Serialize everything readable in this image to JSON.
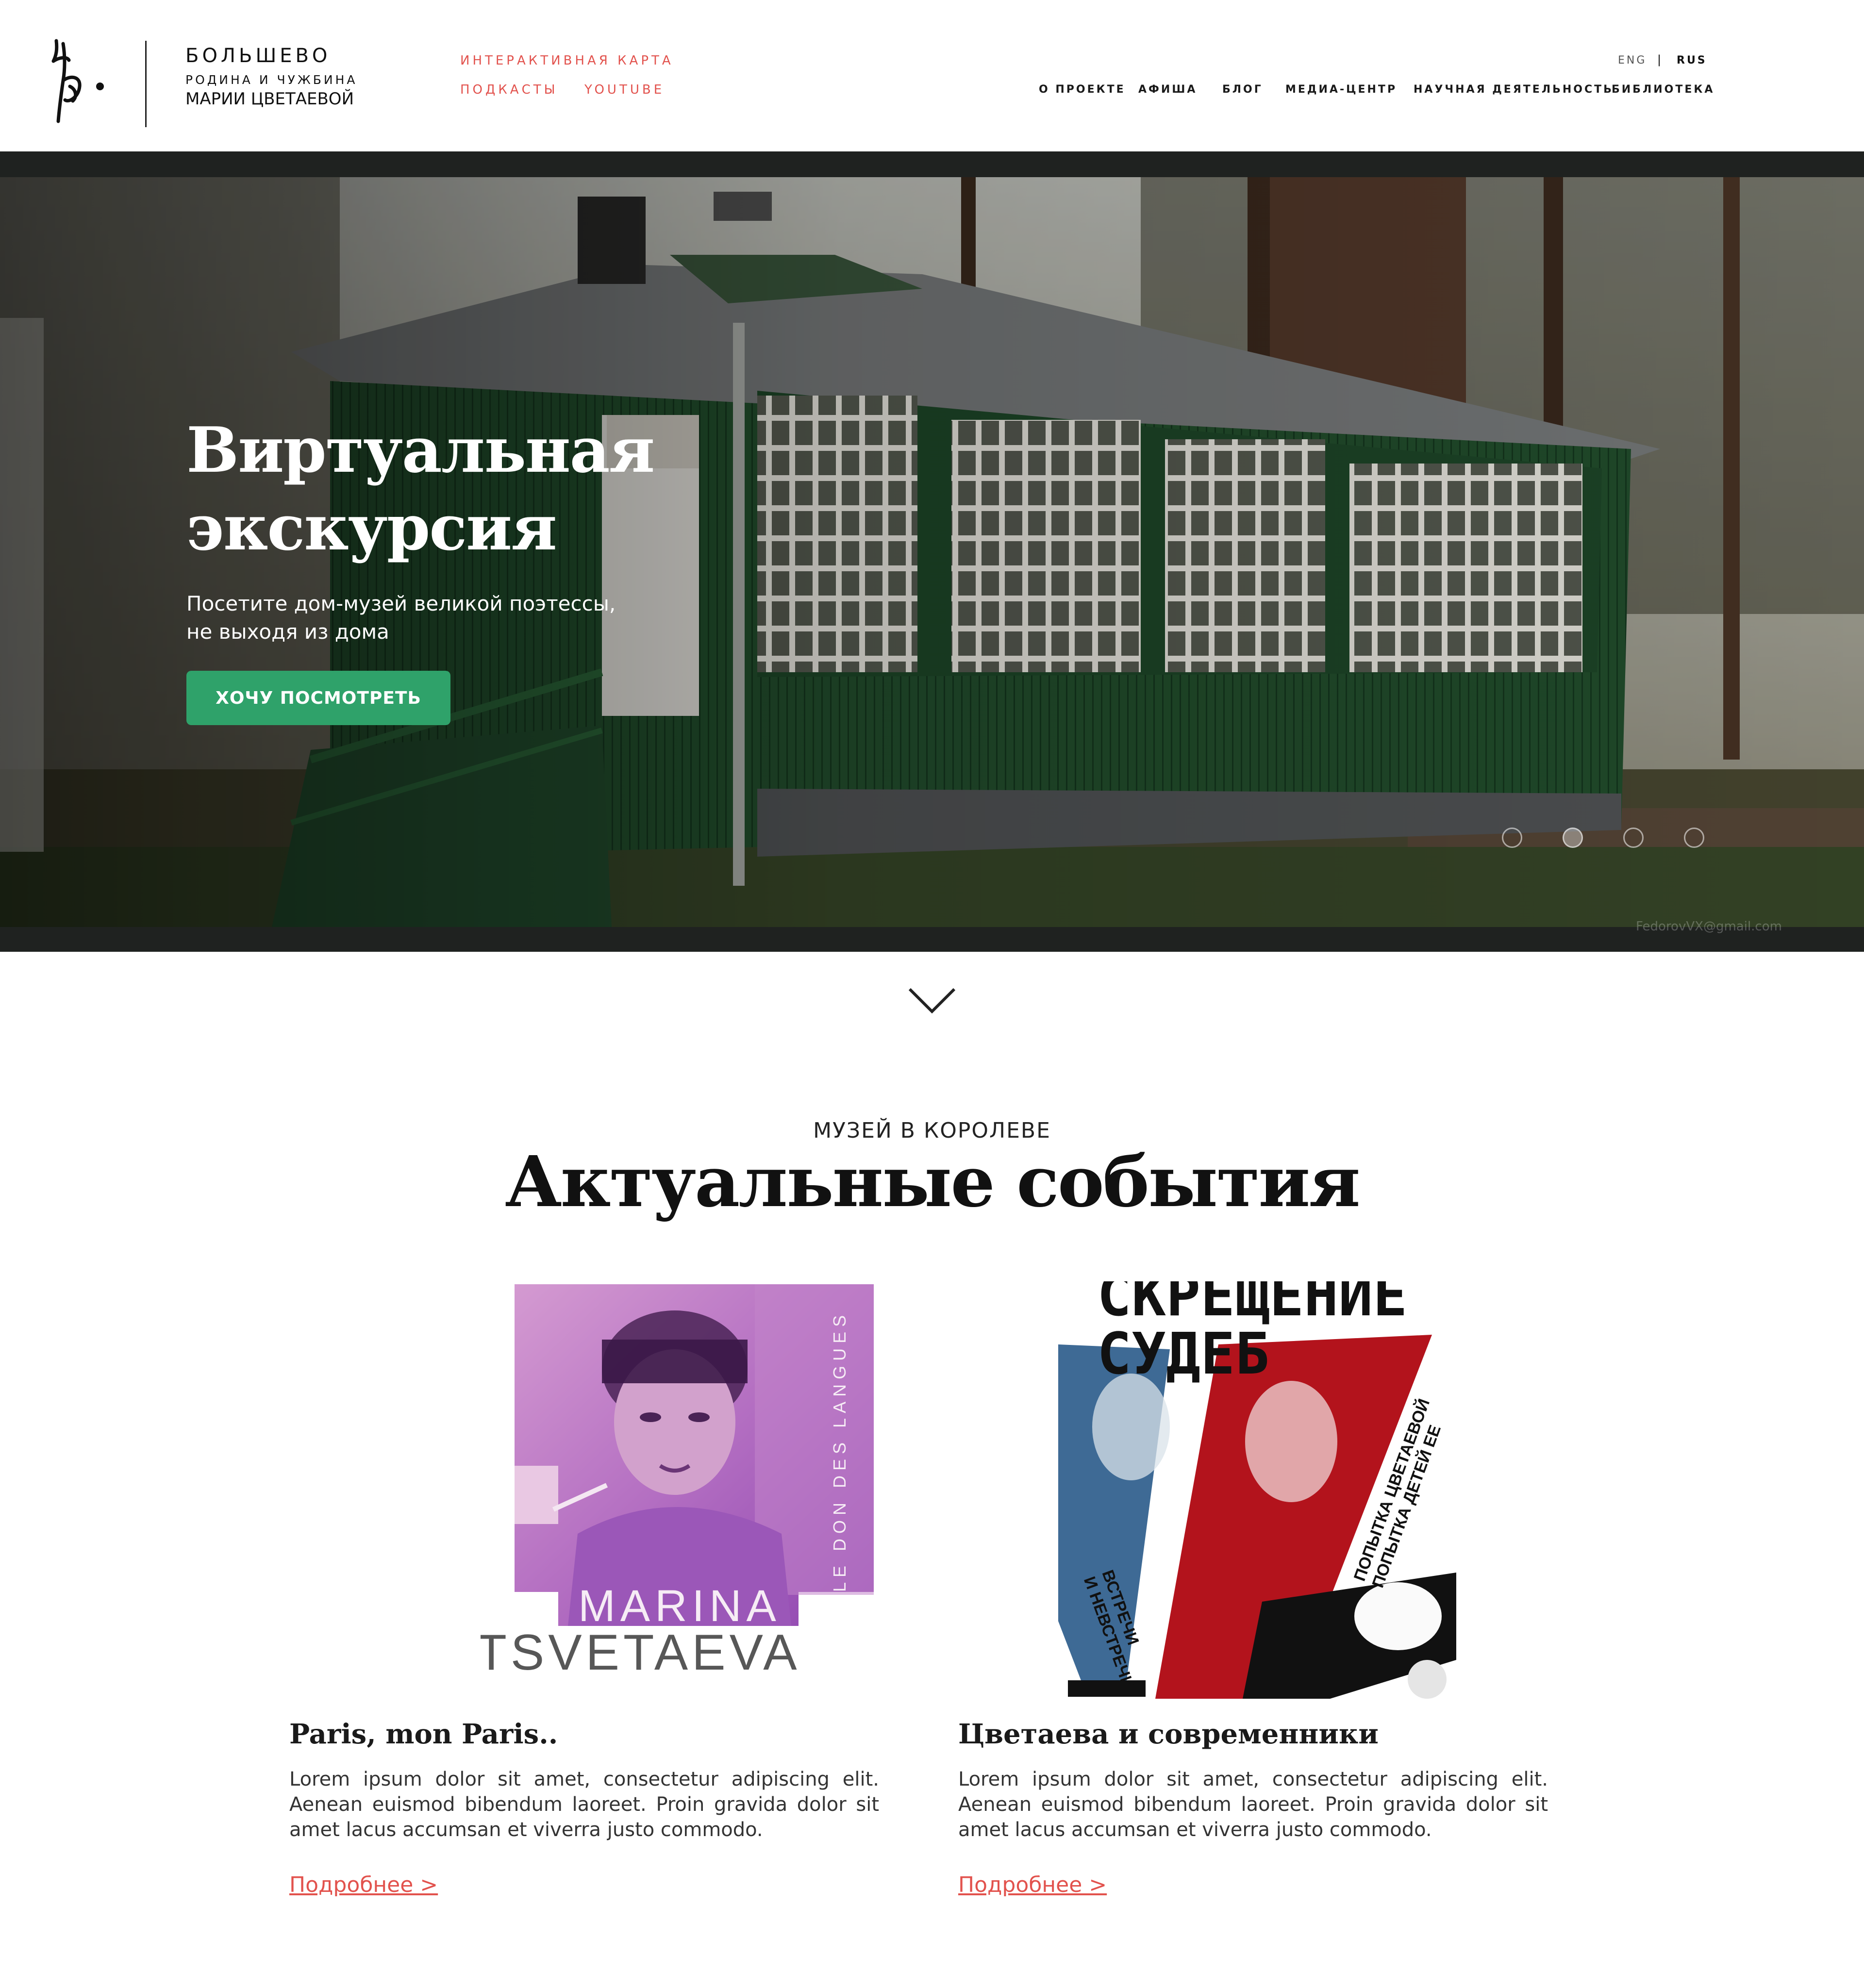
{
  "header": {
    "brand_name": "БОЛЬШЕВО",
    "brand_sub": "РОДИНА И ЧУЖБИНА",
    "brand_sub2": "МАРИИ ЦВЕТАЕВОЙ",
    "top_links": [
      "ИНТЕРАКТИВНАЯ КАРТА",
      "ПОДКАСТЫ",
      "YOUTUBE"
    ],
    "nav": [
      "О ПРОЕКТЕ",
      "АФИША",
      "БЛОГ",
      "МЕДИА-ЦЕНТР",
      "НАУЧНАЯ ДЕЯТЕЛЬНОСТЬ",
      "БИБЛИОТЕКА"
    ],
    "lang_en": "ENG",
    "lang_sep": "|",
    "lang_ru": "RUS",
    "accent_color": "#e2524d"
  },
  "hero": {
    "title_line1": "Виртуальная",
    "title_line2": "экскурсия",
    "text_line1": "Посетите дом-музей великой поэтессы,",
    "text_line2": "не выходя из дома",
    "button": "ХОЧУ ПОСМОТРЕТЬ",
    "button_color": "#2fa26a",
    "slides_total": 4,
    "active_slide": 2,
    "watermark": "FedorovVX@gmail.com"
  },
  "events": {
    "kicker": "МУЗЕЙ В КОРОЛЕВЕ",
    "title": "Актуальные события",
    "cards": [
      {
        "title": "Paris, mon Paris..",
        "text": "Lorem ipsum dolor sit amet, consectetur adipiscing elit. Aenean euismod bibendum laoreet. Proin gravida dolor sit amet lacus accumsan et viverra justo commodo.",
        "link": "Подробнее >",
        "poster": {
          "vertical_text": "LE DON DES LANGUES",
          "name1": "MARINA",
          "name2": "TSVETAEVA"
        }
      },
      {
        "title": "Цветаева и современники",
        "text": "Lorem ipsum dolor sit amet, consectetur adipiscing elit. Aenean euismod bibendum laoreet. Proin gravida dolor sit amet lacus accumsan et viverra justo commodo.",
        "link": "Подробнее >",
        "poster": {
          "head1": "СКРЕЩЕНИЕ",
          "head2": "СУДЕБ",
          "diag1": "ПОПЫТКА ЦВЕТАЕВОЙ",
          "diag2": "ПОПЫТКА ДЕТЕЙ ЕЕ",
          "diag3": "ВСТРЕЧИ",
          "diag4": "И НЕВСТРЕЧИ"
        }
      }
    ]
  },
  "icons": {
    "logo": "tsvetaeva-monogram-icon",
    "scroll": "chevron-down-icon"
  }
}
